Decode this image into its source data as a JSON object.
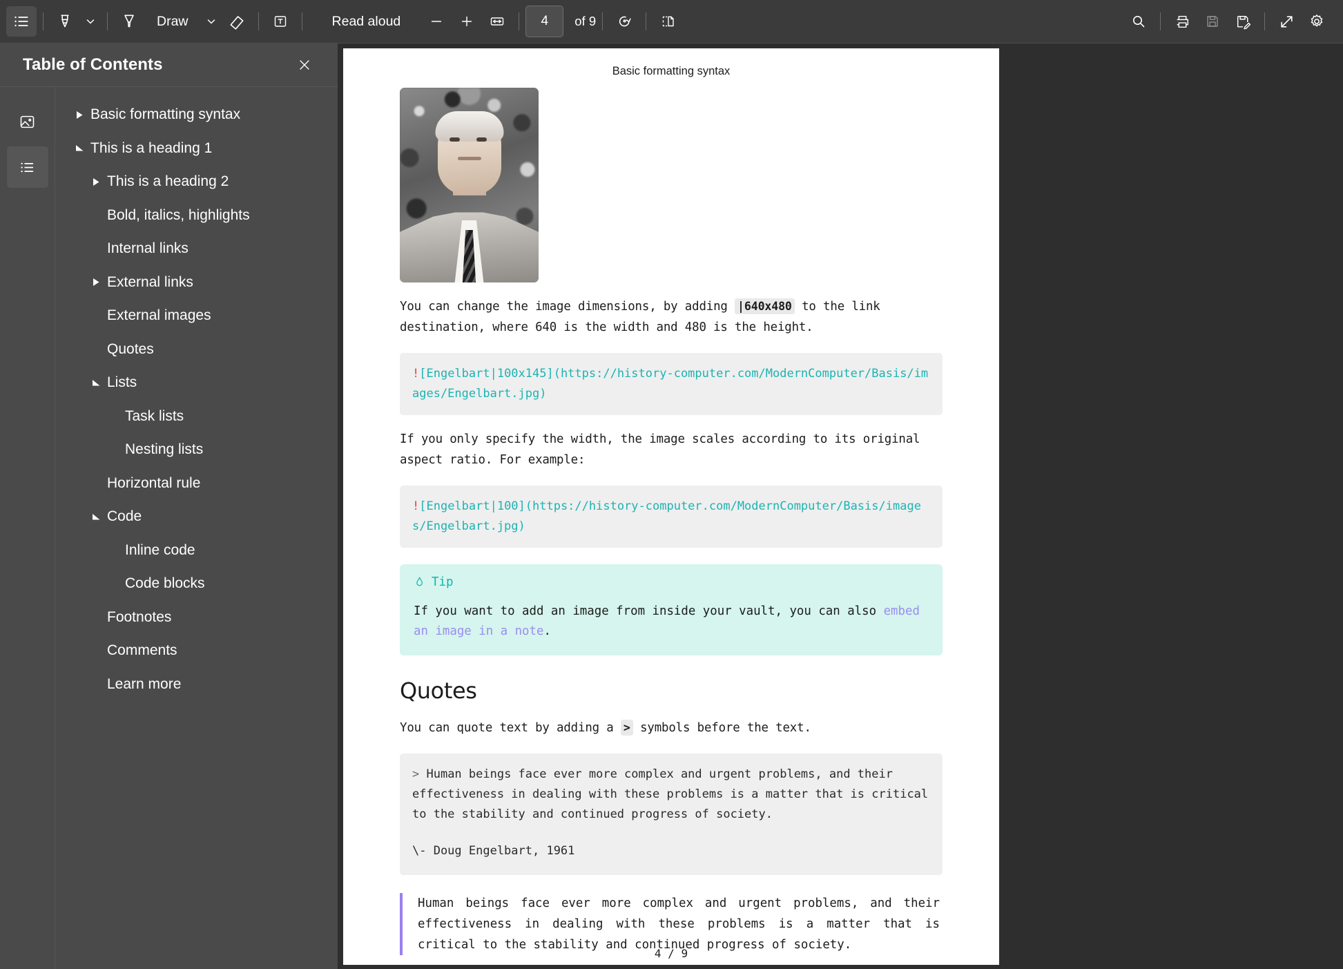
{
  "toolbar": {
    "toc_toggle": "table-of-contents-toggle",
    "highlighter": "highlighter",
    "highlighter_chevron": "highlighter-options",
    "draw_label": "Draw",
    "draw_chevron": "draw-options",
    "eraser": "eraser",
    "text_tool": "add-text",
    "read_aloud_label": "Read aloud",
    "zoom_out": "zoom-out",
    "zoom_in": "zoom-in",
    "fit_page": "fit-to-width",
    "current_page": "4",
    "of_pages": "of 9",
    "rotate": "rotate",
    "page_view": "page-view",
    "search": "search",
    "print": "print",
    "save": "save",
    "save_as": "save-as",
    "fullscreen": "fullscreen",
    "settings": "settings"
  },
  "toc": {
    "title": "Table of Contents",
    "close": "close",
    "rail": [
      {
        "icon": "thumbnails-icon",
        "selected": false
      },
      {
        "icon": "list-icon",
        "selected": true
      }
    ],
    "items": [
      {
        "label": "Basic formatting syntax",
        "level": 0,
        "marker": "collapsed"
      },
      {
        "label": "This is a heading 1",
        "level": 0,
        "marker": "expanded"
      },
      {
        "label": "This is a heading 2",
        "level": 1,
        "marker": "collapsed"
      },
      {
        "label": "Bold, italics, highlights",
        "level": 1,
        "marker": "none"
      },
      {
        "label": "Internal links",
        "level": 1,
        "marker": "none"
      },
      {
        "label": "External links",
        "level": 1,
        "marker": "collapsed"
      },
      {
        "label": "External images",
        "level": 1,
        "marker": "none"
      },
      {
        "label": "Quotes",
        "level": 1,
        "marker": "none"
      },
      {
        "label": "Lists",
        "level": 1,
        "marker": "expanded"
      },
      {
        "label": "Task lists",
        "level": 2,
        "marker": "none"
      },
      {
        "label": "Nesting lists",
        "level": 2,
        "marker": "none"
      },
      {
        "label": "Horizontal rule",
        "level": 1,
        "marker": "none"
      },
      {
        "label": "Code",
        "level": 1,
        "marker": "expanded"
      },
      {
        "label": "Inline code",
        "level": 2,
        "marker": "none"
      },
      {
        "label": "Code blocks",
        "level": 2,
        "marker": "none"
      },
      {
        "label": "Footnotes",
        "level": 1,
        "marker": "none"
      },
      {
        "label": "Comments",
        "level": 1,
        "marker": "none"
      },
      {
        "label": "Learn more",
        "level": 1,
        "marker": "none"
      }
    ]
  },
  "document": {
    "header": "Basic formatting syntax",
    "footer": "4 / 9",
    "image_alt": "Portrait of Doug Engelbart",
    "para1_a": "You can change the image dimensions, by adding ",
    "para1_code": "|640x480",
    "para1_b": " to the link destination, where 640 is the width and 480 is the height.",
    "code1_bang": "!",
    "code1_rest": "[Engelbart|100x145](https://history-computer.com/ModernComputer/Basis/images/Engelbart.jpg)",
    "para2": "If you only specify the width, the image scales according to its original aspect ratio. For example:",
    "code2_bang": "!",
    "code2_rest": "[Engelbart|100](https://history-computer.com/ModernComputer/Basis/images/Engelbart.jpg)",
    "callout_title": "Tip",
    "callout_icon": "flame-icon",
    "callout_text_a": "If you want to add an image from inside your vault, you can also ",
    "callout_link": "embed an image in a note",
    "callout_text_b": ".",
    "quotes_heading": "Quotes",
    "para3_a": "You can quote text by adding a ",
    "para3_code": ">",
    "para3_b": " symbols before the text.",
    "quote_code_marker": ">",
    "quote_code_text": " Human beings face ever more complex and urgent problems, and their effectiveness in dealing with these problems is a matter that is critical to the stability and continued progress of society.",
    "quote_code_attrib": "\\- Doug Engelbart, 1961",
    "blockquote_text": "Human beings face ever more complex and urgent problems, and their effectiveness in dealing with these problems is a matter that is critical to the stability and continued progress of society."
  },
  "colors": {
    "toolbar_bg": "#3b3b3b",
    "panel_bg": "#4a4a4a",
    "viewer_bg": "#2e2e2e",
    "page_bg": "#ffffff",
    "code_text": "#1cb3b3",
    "code_bang": "#e8413e",
    "callout_bg": "#d5f5ee",
    "callout_accent": "#0bb8b0",
    "link": "#9b8df0",
    "quote_border": "#9b7ef0"
  }
}
